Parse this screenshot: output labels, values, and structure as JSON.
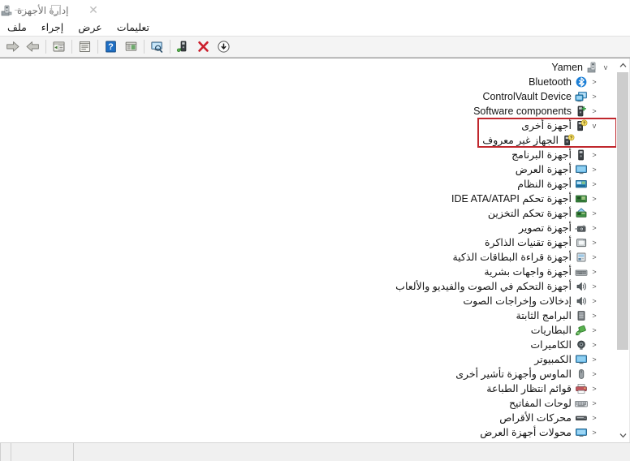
{
  "window": {
    "title": "إدارة الأجهزة",
    "title_icon": "device-manager-icon",
    "controls": {
      "close": "✕",
      "maximize": "□",
      "minimize": "—"
    }
  },
  "menubar": {
    "items": [
      {
        "label": "ملف",
        "name": "menu-file"
      },
      {
        "label": "إجراء",
        "name": "menu-action"
      },
      {
        "label": "عرض",
        "name": "menu-view"
      },
      {
        "label": "تعليمات",
        "name": "menu-help"
      }
    ]
  },
  "toolbar": {
    "buttons": [
      {
        "name": "forward-button",
        "icon": "arrow-right-icon",
        "tip": "إلى الأمام"
      },
      {
        "name": "back-button",
        "icon": "arrow-left-icon",
        "tip": "رجوع"
      },
      {
        "name": "show-hidden-devices-button",
        "icon": "show-hidden-icon",
        "tip": "إظهار الأجهزة المخفية"
      },
      {
        "name": "properties-button",
        "icon": "properties-icon",
        "tip": "خصائص"
      },
      {
        "name": "help-button",
        "icon": "help-question-icon",
        "tip": "تعليمات"
      },
      {
        "name": "update-driver-button",
        "icon": "update-driver-icon",
        "tip": "تحديث برنامج التشغيل"
      },
      {
        "name": "scan-hardware-button",
        "icon": "scan-monitor-icon",
        "tip": "البحث عن تغييرات الأجهزة"
      },
      {
        "name": "scan-changes-button",
        "icon": "scan-device-icon",
        "tip": "فحص تغييرات الأجهزة"
      },
      {
        "name": "uninstall-device-button",
        "icon": "red-x-icon",
        "tip": "إلغاء تثبيت الجهاز"
      },
      {
        "name": "download-driver-button",
        "icon": "download-circle-icon",
        "tip": "تنزيل"
      }
    ]
  },
  "tree": {
    "root": {
      "label": "Yamen",
      "icon": "computer-tower-icon",
      "expanded": true,
      "chevron": "v"
    },
    "items": [
      {
        "label": "Bluetooth",
        "icon": "bluetooth-icon",
        "level": 2,
        "chevron": "<",
        "warning": false,
        "highlighted": false
      },
      {
        "label": "ControlVault Device",
        "icon": "controlvault-icon",
        "level": 2,
        "chevron": "<",
        "warning": false,
        "highlighted": false
      },
      {
        "label": "Software components",
        "icon": "software-component-icon",
        "level": 2,
        "chevron": "<",
        "warning": false,
        "highlighted": false
      },
      {
        "label": "أجهزة أخرى",
        "icon": "unknown-device-icon",
        "level": 2,
        "chevron": "v",
        "warning": true,
        "highlighted": true
      },
      {
        "label": "الجهاز غير معروف",
        "icon": "unknown-device-icon",
        "level": 3,
        "chevron": "",
        "warning": true,
        "highlighted": true
      },
      {
        "label": "أجهزة البرنامج",
        "icon": "software-device-icon",
        "level": 2,
        "chevron": "<",
        "warning": false,
        "highlighted": false
      },
      {
        "label": "أجهزة العرض",
        "icon": "monitor-icon",
        "level": 2,
        "chevron": "<",
        "warning": false,
        "highlighted": false
      },
      {
        "label": "أجهزة النظام",
        "icon": "system-device-icon",
        "level": 2,
        "chevron": "<",
        "warning": false,
        "highlighted": false
      },
      {
        "label": "أجهزة تحكم IDE ATA/ATAPI",
        "icon": "ide-controller-icon",
        "level": 2,
        "chevron": "<",
        "warning": false,
        "highlighted": false
      },
      {
        "label": "أجهزة تحكم التخزين",
        "icon": "storage-controller-icon",
        "level": 2,
        "chevron": "<",
        "warning": false,
        "highlighted": false
      },
      {
        "label": "أجهزة تصوير",
        "icon": "imaging-device-icon",
        "level": 2,
        "chevron": "<",
        "warning": false,
        "highlighted": false
      },
      {
        "label": "أجهزة تقنيات الذاكرة",
        "icon": "memory-technology-icon",
        "level": 2,
        "chevron": "<",
        "warning": false,
        "highlighted": false
      },
      {
        "label": "أجهزة قراءة البطاقات الذكية",
        "icon": "smart-card-reader-icon",
        "level": 2,
        "chevron": "<",
        "warning": false,
        "highlighted": false
      },
      {
        "label": "أجهزة واجهات بشرية",
        "icon": "human-interface-icon",
        "level": 2,
        "chevron": "<",
        "warning": false,
        "highlighted": false
      },
      {
        "label": "أجهزة التحكم في الصوت والفيديو والألعاب",
        "icon": "sound-video-game-icon",
        "level": 2,
        "chevron": "<",
        "warning": false,
        "highlighted": false
      },
      {
        "label": "إدخالات وإخراجات الصوت",
        "icon": "audio-io-icon",
        "level": 2,
        "chevron": "<",
        "warning": false,
        "highlighted": false
      },
      {
        "label": "البرامج الثابتة",
        "icon": "firmware-icon",
        "level": 2,
        "chevron": "<",
        "warning": false,
        "highlighted": false
      },
      {
        "label": "البطاريات",
        "icon": "battery-icon",
        "level": 2,
        "chevron": "<",
        "warning": false,
        "highlighted": false
      },
      {
        "label": "الكاميرات",
        "icon": "camera-icon",
        "level": 2,
        "chevron": "<",
        "warning": false,
        "highlighted": false
      },
      {
        "label": "الكمبيوتر",
        "icon": "computer-icon",
        "level": 2,
        "chevron": "<",
        "warning": false,
        "highlighted": false
      },
      {
        "label": "الماوس وأجهزة تأشير أخرى",
        "icon": "mouse-icon",
        "level": 2,
        "chevron": "<",
        "warning": false,
        "highlighted": false
      },
      {
        "label": "قوائم انتظار الطباعة",
        "icon": "print-queue-icon",
        "level": 2,
        "chevron": "<",
        "warning": false,
        "highlighted": false
      },
      {
        "label": "لوحات المفاتيح",
        "icon": "keyboard-icon",
        "level": 2,
        "chevron": "<",
        "warning": false,
        "highlighted": false
      },
      {
        "label": "محركات الأقراص",
        "icon": "disk-drive-icon",
        "level": 2,
        "chevron": "<",
        "warning": false,
        "highlighted": false
      },
      {
        "label": "محولات أجهزة العرض",
        "icon": "display-adapter-icon",
        "level": 2,
        "chevron": "<",
        "warning": false,
        "highlighted": false
      }
    ]
  },
  "annotation": {
    "type": "red-rectangle",
    "color": "#c0272d",
    "targets": [
      "أجهزة أخرى",
      "الجهاز غير معروف"
    ]
  },
  "scrollbar": {
    "up_arrow": "⌃",
    "down_arrow": "⌄",
    "thumb_percent": 78
  },
  "statusbar": {
    "text": ""
  }
}
